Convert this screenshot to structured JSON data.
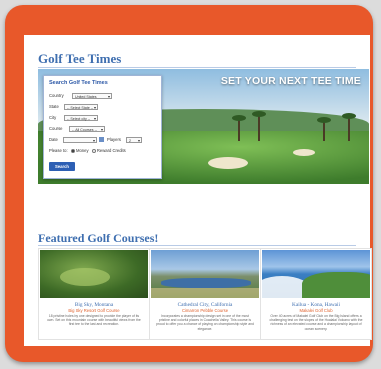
{
  "page": {
    "title": "Golf Tee Times",
    "tagline": "SET YOUR NEXT TEE TIME",
    "featured_title": "Featured Golf Courses!"
  },
  "search": {
    "title": "Search Golf Tee Times",
    "country_label": "Country",
    "country_value": "United States",
    "state_label": "State",
    "state_value": "-- Select State --",
    "city_label": "City",
    "city_value": "-- Select city --",
    "course_label": "Course",
    "course_value": "-- All Courses --",
    "date_label": "Date",
    "players_label": "Players",
    "players_value": "2",
    "pay_label": "Please to:",
    "pay_option_money": "Money",
    "pay_option_credits": "Reward Credits",
    "button_label": "Search"
  },
  "courses": [
    {
      "location": "Big Sky, Montana",
      "name": "Big Sky Resort Golf Course",
      "description": "18 pristine holes by one designed to provide the player of its own. Set on this mountain course with beautiful views from the first tee to the last and recreation."
    },
    {
      "location": "Cathedral City, California",
      "name": "Cimarron Pebble Course",
      "description": "Incorporates a championship design set in one of the most pristine and colorful places in Coachella Valley. This course is proud to offer you a chance of playing on championship style and elegance."
    },
    {
      "location": "Kailua - Kona, Hawaii",
      "name": "Makalei Golf Club",
      "description": "Over 40 acres of Makalei Golf Club on the Big Island offers a challenging test on the slopes of the Hualalai Volcano with the richness of an elevated course and a championship layout of ocean scenery."
    }
  ],
  "colors": {
    "frame": "#e8582a",
    "title": "#3f6fb0",
    "accent": "#e0622e",
    "button": "#2d5fb4"
  }
}
